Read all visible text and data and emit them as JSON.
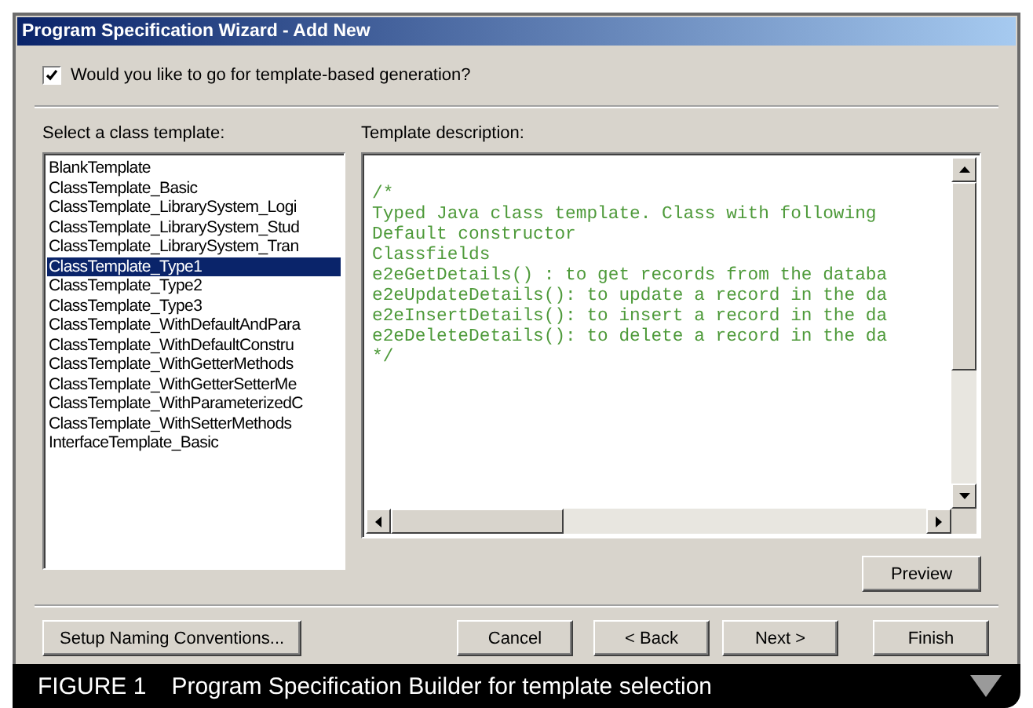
{
  "window": {
    "title": "Program Specification Wizard - Add New"
  },
  "template_checkbox": {
    "label": "Would you like to go for template-based generation?",
    "checked": true
  },
  "templates": {
    "label": "Select a class template:",
    "items": [
      {
        "text": "BlankTemplate",
        "selected": false
      },
      {
        "text": "ClassTemplate_Basic",
        "selected": false
      },
      {
        "text": "ClassTemplate_LibrarySystem_Logi",
        "selected": false
      },
      {
        "text": "ClassTemplate_LibrarySystem_Stud",
        "selected": false
      },
      {
        "text": "ClassTemplate_LibrarySystem_Tran",
        "selected": false
      },
      {
        "text": "ClassTemplate_Type1",
        "selected": true
      },
      {
        "text": "ClassTemplate_Type2",
        "selected": false
      },
      {
        "text": "ClassTemplate_Type3",
        "selected": false
      },
      {
        "text": "ClassTemplate_WithDefaultAndPara",
        "selected": false
      },
      {
        "text": "ClassTemplate_WithDefaultConstru",
        "selected": false
      },
      {
        "text": "ClassTemplate_WithGetterMethods",
        "selected": false
      },
      {
        "text": "ClassTemplate_WithGetterSetterMe",
        "selected": false
      },
      {
        "text": "ClassTemplate_WithParameterizedC",
        "selected": false
      },
      {
        "text": "ClassTemplate_WithSetterMethods",
        "selected": false
      },
      {
        "text": "InterfaceTemplate_Basic",
        "selected": false
      }
    ]
  },
  "description": {
    "label": "Template description:",
    "lines": [
      "/*",
      "Typed Java class template. Class with following",
      "Default constructor",
      "Classfields",
      "e2eGetDetails() : to get records from the databa",
      "e2eUpdateDetails(): to update a record in the da",
      "e2eInsertDetails(): to insert a record in the da",
      "e2eDeleteDetails(): to delete a record in the da",
      "*/"
    ]
  },
  "preview_button": "Preview",
  "setup_button": "Setup Naming Conventions...",
  "buttons": [
    "Cancel",
    "< Back",
    "Next >",
    "Finish"
  ],
  "caption": {
    "label": "FIGURE 1",
    "text": "Program Specification Builder for template selection"
  }
}
